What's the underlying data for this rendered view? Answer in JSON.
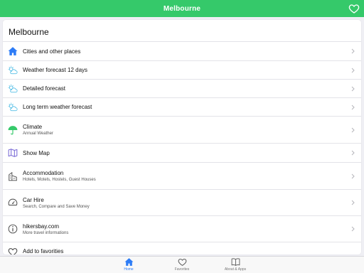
{
  "topbar": {
    "title": "Melbourne",
    "favorite_icon": "heart-outline-icon"
  },
  "card": {
    "title": "Melbourne"
  },
  "items": [
    {
      "label": "Cities and other places",
      "sub": "",
      "icon": "home-icon"
    },
    {
      "label": "Weather forecast 12 days",
      "sub": "",
      "icon": "weather-icon"
    },
    {
      "label": "Detailed forecast",
      "sub": "",
      "icon": "weather-icon"
    },
    {
      "label": "Long term weather forecast",
      "sub": "",
      "icon": "weather-icon"
    },
    {
      "label": "Climate",
      "sub": "Annual Weather",
      "icon": "umbrella-icon"
    },
    {
      "label": "Show Map",
      "sub": "",
      "icon": "map-icon"
    },
    {
      "label": "Accommodation",
      "sub": "Hotels, Motels, Hostels, Guest Houses",
      "icon": "building-icon"
    },
    {
      "label": "Car Hire",
      "sub": "Search, Compare and Save Money",
      "icon": "speedometer-icon"
    },
    {
      "label": "hikersbay.com",
      "sub": "More travel informations",
      "icon": "info-icon"
    },
    {
      "label": "Add to favorities",
      "sub": "",
      "icon": "heart-icon"
    }
  ],
  "tabs": [
    {
      "label": "Home",
      "icon": "house-icon",
      "active": true
    },
    {
      "label": "Favorites",
      "icon": "heart-icon",
      "active": false
    },
    {
      "label": "About & Apps",
      "icon": "book-icon",
      "active": false
    }
  ],
  "colors": {
    "brand": "#35c96a",
    "active_tab": "#2d7cf6",
    "home_icon": "#2d7cf6",
    "weather_icon": "#55bfe6",
    "umbrella_icon": "#35c96a",
    "map_icon": "#7a6bd6"
  }
}
